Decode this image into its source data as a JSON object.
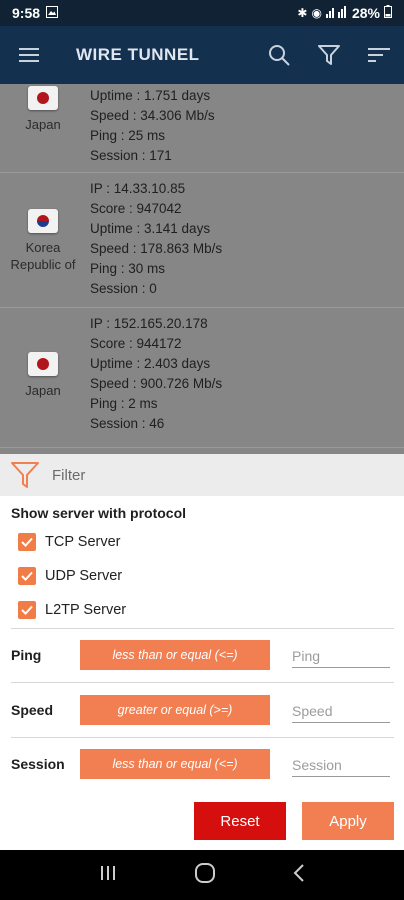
{
  "status_bar": {
    "time": "9:58",
    "battery": "28%"
  },
  "app_bar": {
    "title": "WIRE TUNNEL"
  },
  "servers": [
    {
      "country": "Japan",
      "flag": "japan",
      "ip": "",
      "score": "",
      "uptime": "Uptime : 1.751 days",
      "speed": "Speed : 34.306 Mb/s",
      "ping": "Ping : 25 ms",
      "session": "Session : 171"
    },
    {
      "country": "Korea Republic of",
      "flag": "korea",
      "ip": "IP : 14.33.10.85",
      "score": "Score : 947042",
      "uptime": "Uptime : 3.141 days",
      "speed": "Speed : 178.863 Mb/s",
      "ping": "Ping : 30 ms",
      "session": "Session : 0"
    },
    {
      "country": "Japan",
      "flag": "japan",
      "ip": "IP : 152.165.20.178",
      "score": "Score : 944172",
      "uptime": "Uptime : 2.403 days",
      "speed": "Speed : 900.726 Mb/s",
      "ping": "Ping : 2 ms",
      "session": "Session : 46"
    }
  ],
  "filter_sheet": {
    "title": "Filter",
    "protocol_title": "Show server with protocol",
    "protocols": [
      {
        "label": "TCP Server",
        "checked": true
      },
      {
        "label": "UDP Server",
        "checked": true
      },
      {
        "label": "L2TP Server",
        "checked": true
      }
    ],
    "filters": [
      {
        "name": "Ping",
        "operator": "less than or equal (<=)",
        "placeholder": "Ping"
      },
      {
        "name": "Speed",
        "operator": "greater or equal (>=)",
        "placeholder": "Speed"
      },
      {
        "name": "Session",
        "operator": "less than or equal (<=)",
        "placeholder": "Session"
      }
    ],
    "reset_label": "Reset",
    "apply_label": "Apply"
  },
  "colors": {
    "accent": "#f27f52",
    "reset": "#d50e0e",
    "app_bar": "#14304f"
  },
  "icons": [
    "menu-icon",
    "search-icon",
    "filter-icon",
    "sort-icon",
    "recents-icon",
    "home-icon",
    "back-icon"
  ]
}
